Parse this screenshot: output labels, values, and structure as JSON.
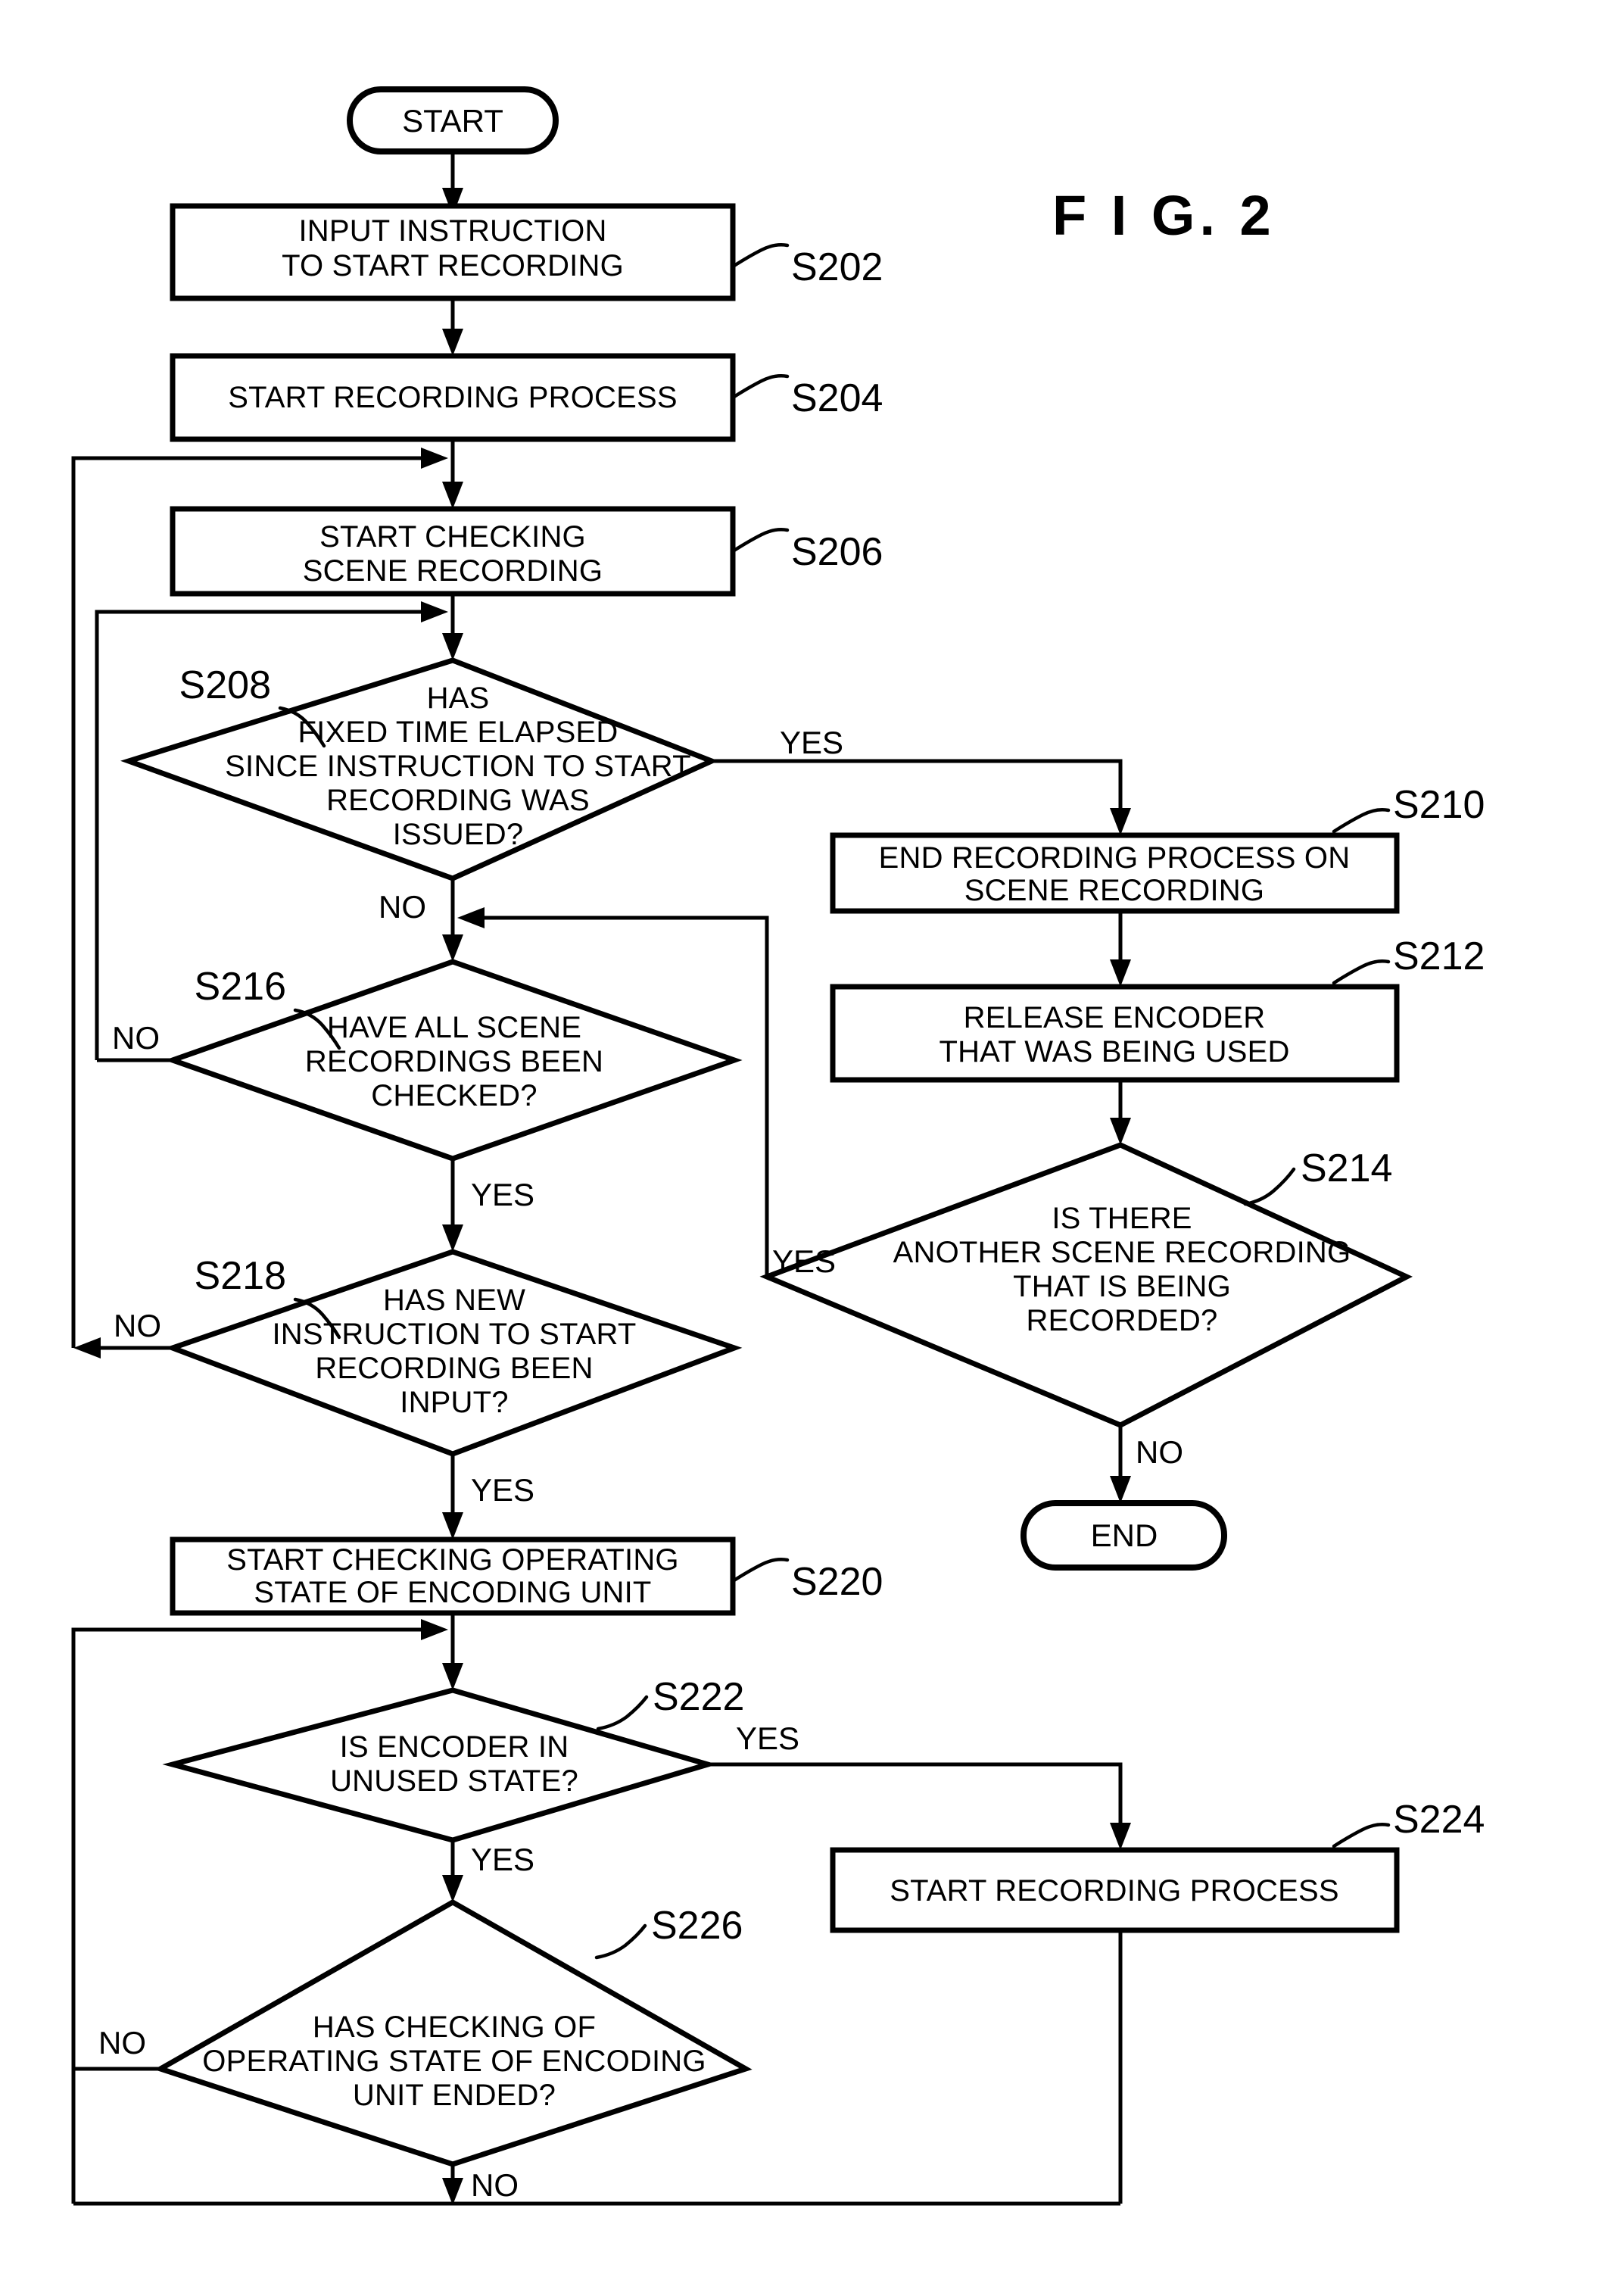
{
  "figure": {
    "title": "F I G.  2",
    "title_plain": "FIG. 2"
  },
  "nodes": {
    "start": {
      "ref": "",
      "label": "START",
      "shape": "terminator"
    },
    "s202": {
      "ref": "S202",
      "lines": [
        "INPUT INSTRUCTION",
        "TO START RECORDING"
      ],
      "shape": "process"
    },
    "s204": {
      "ref": "S204",
      "lines": [
        "START RECORDING PROCESS"
      ],
      "shape": "process"
    },
    "s206": {
      "ref": "S206",
      "lines": [
        "START CHECKING",
        "SCENE RECORDING"
      ],
      "shape": "process"
    },
    "s208": {
      "ref": "S208",
      "lines": [
        "HAS",
        "FIXED TIME ELAPSED",
        "SINCE INSTRUCTION TO START",
        "RECORDING WAS",
        "ISSUED?"
      ],
      "shape": "decision"
    },
    "s210": {
      "ref": "S210",
      "lines": [
        "END RECORDING PROCESS ON",
        "SCENE RECORDING"
      ],
      "shape": "process"
    },
    "s212": {
      "ref": "S212",
      "lines": [
        "RELEASE ENCODER",
        "THAT WAS BEING USED"
      ],
      "shape": "process"
    },
    "s214": {
      "ref": "S214",
      "lines": [
        "IS THERE",
        "ANOTHER SCENE RECORDING",
        "THAT IS BEING",
        "RECORDED?"
      ],
      "shape": "decision"
    },
    "s216": {
      "ref": "S216",
      "lines": [
        "HAVE ALL SCENE",
        "RECORDINGS BEEN",
        "CHECKED?"
      ],
      "shape": "decision"
    },
    "s218": {
      "ref": "S218",
      "lines": [
        "HAS NEW",
        "INSTRUCTION TO START",
        "RECORDING BEEN",
        "INPUT?"
      ],
      "shape": "decision"
    },
    "s220": {
      "ref": "S220",
      "lines": [
        "START CHECKING OPERATING",
        "STATE OF ENCODING UNIT"
      ],
      "shape": "process"
    },
    "s222": {
      "ref": "S222",
      "lines": [
        "IS ENCODER IN",
        "UNUSED STATE?"
      ],
      "shape": "decision"
    },
    "s224": {
      "ref": "S224",
      "lines": [
        "START RECORDING PROCESS"
      ],
      "shape": "process"
    },
    "s226": {
      "ref": "S226",
      "lines": [
        "HAS CHECKING OF",
        "OPERATING STATE OF ENCODING",
        "UNIT ENDED?"
      ],
      "shape": "decision"
    },
    "end": {
      "ref": "",
      "label": "END",
      "shape": "terminator"
    }
  },
  "branch_labels": {
    "s208_yes": "YES",
    "s208_no": "NO",
    "s216_no": "NO",
    "s216_yes": "YES",
    "s218_no": "NO",
    "s218_yes": "YES",
    "s214_yes": "YES",
    "s214_no": "NO",
    "s222_yes": "YES",
    "s222_no_down": "YES",
    "s226_no_left": "NO",
    "s226_no_down": "NO"
  },
  "colors": {
    "ink": "#000000",
    "paper": "#ffffff"
  }
}
